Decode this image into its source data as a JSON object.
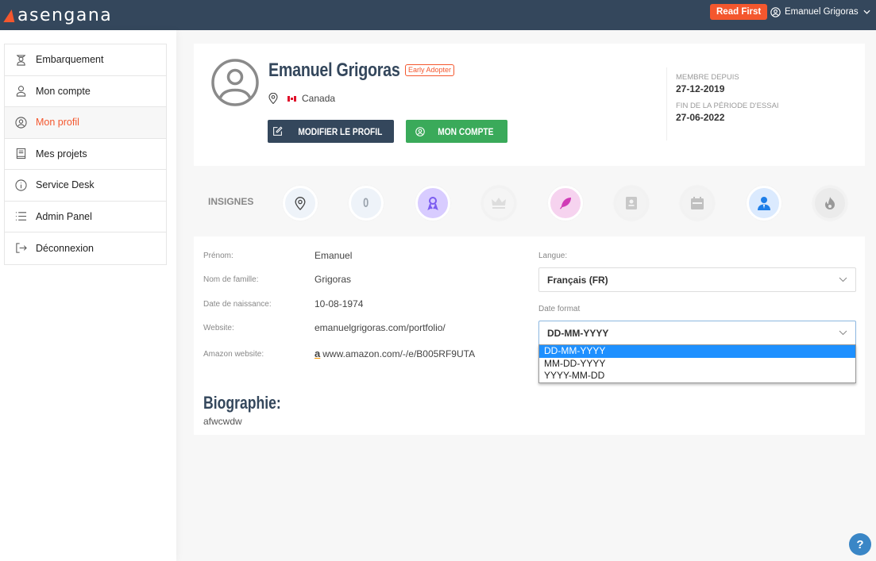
{
  "topbar": {
    "logo": "asengana",
    "read_first": "Read First",
    "user_name": "Emanuel Grigoras"
  },
  "sidebar": {
    "items": [
      {
        "label": "Embarquement",
        "icon": "graduate-icon",
        "active": false
      },
      {
        "label": "Mon compte",
        "icon": "user-icon",
        "active": false
      },
      {
        "label": "Mon profil",
        "icon": "user-circle-icon",
        "active": true
      },
      {
        "label": "Mes projets",
        "icon": "book-icon",
        "active": false
      },
      {
        "label": "Service Desk",
        "icon": "info-icon",
        "active": false
      },
      {
        "label": "Admin Panel",
        "icon": "list-icon",
        "active": false
      },
      {
        "label": "Déconnexion",
        "icon": "logout-icon",
        "active": false
      }
    ]
  },
  "profile": {
    "name": "Emanuel Grigoras",
    "badge": "Early Adopter",
    "country": "Canada",
    "edit_button": "MODIFIER LE PROFIL",
    "account_button": "MON COMPTE",
    "member_since_label": "MEMBRE DEPUIS",
    "member_since": "27-12-2019",
    "trial_end_label": "FIN DE LA PÉRIODE D'ESSAI",
    "trial_end": "27-06-2022"
  },
  "badges": {
    "label": "INSIGNES",
    "items": [
      {
        "name": "location-badge",
        "bg": "#eef3f9",
        "color": "#444",
        "active": true
      },
      {
        "name": "zero-badge",
        "text": "0",
        "bg": "#eef3f9",
        "color": "#99a",
        "active": true
      },
      {
        "name": "award-badge",
        "bg": "#d8ccff",
        "color": "#7b5cf0",
        "active": true
      },
      {
        "name": "crown-badge",
        "bg": "#f5f5f5",
        "color": "#ddd",
        "active": false
      },
      {
        "name": "feather-badge",
        "bg": "#f6d3ef",
        "color": "#d03ab6",
        "active": true
      },
      {
        "name": "contact-badge",
        "bg": "#f3f3f3",
        "color": "#c8c8c8",
        "active": false
      },
      {
        "name": "calendar-badge",
        "bg": "#f3f3f3",
        "color": "#c0c0c0",
        "active": false
      },
      {
        "name": "businessman-badge",
        "bg": "#dbeafe",
        "color": "#1e7ee8",
        "active": true
      },
      {
        "name": "fire-badge",
        "bg": "#ebebeb",
        "color": "#999",
        "active": false
      }
    ]
  },
  "details": {
    "fields": [
      {
        "label": "Prénom:",
        "value": "Emanuel"
      },
      {
        "label": "Nom de famille:",
        "value": "Grigoras"
      },
      {
        "label": "Date de naissance:",
        "value": "10-08-1974"
      },
      {
        "label": "Website:",
        "value": "emanuelgrigoras.com/portfolio/"
      },
      {
        "label": "Amazon website:",
        "value": "www.amazon.com/-/e/B005RF9UTA"
      }
    ],
    "language_label": "Langue:",
    "language_value": "Français (FR)",
    "date_format_label": "Date format",
    "date_format_value": "DD-MM-YYYY",
    "date_format_options": [
      "DD-MM-YYYY",
      "MM-DD-YYYY",
      "YYYY-MM-DD"
    ],
    "bio_title": "Biographie:",
    "bio_text": "afwcwdw"
  },
  "help": "?"
}
